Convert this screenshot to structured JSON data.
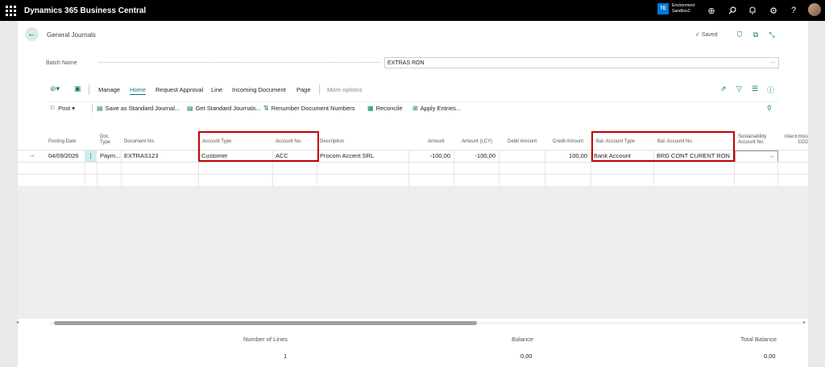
{
  "app": {
    "title": "Dynamics 365 Business Central"
  },
  "environment": {
    "badge": "TE",
    "label": "Environment:",
    "name": "Sandbox2"
  },
  "page": {
    "title": "General Journals",
    "status": "Saved"
  },
  "batch": {
    "label": "Batch Name",
    "value": "EXTRAS RON",
    "more": "···"
  },
  "actions": {
    "items": [
      "Manage",
      "Home",
      "Request Approval",
      "Line",
      "Incoming Document",
      "Page",
      "More options"
    ],
    "active": "Home"
  },
  "ribbon": {
    "post": "Post",
    "save_std": "Save as Standard Journal...",
    "get_std": "Get Standard Journals...",
    "renumber": "Renumber Document Numbers",
    "reconcile": "Reconcile",
    "apply": "Apply Entries..."
  },
  "columns": {
    "posting_date": "Posting Date",
    "doc_type": "Doc. Type",
    "doc_no": "Document No.",
    "account_type": "Account Type",
    "account_no": "Account No.",
    "description": "Description",
    "amount": "Amount",
    "amount_lcy": "Amount (LCY)",
    "debit": "Debit Amount",
    "credit": "Credit Amount",
    "bal_type": "Bal. Account Type",
    "bal_no": "Bal. Account No.",
    "sust_acc": "Sustainability Account No.",
    "total_emission": "Total Emiss CO2"
  },
  "rows": [
    {
      "posting_date": "04/09/2026",
      "doc_type": "Paym...",
      "doc_no": "EXTRAS123",
      "account_type": "Customer",
      "account_no": "ACC",
      "description": "Procom Accent SRL",
      "amount": "-100,00",
      "amount_lcy": "-100,00",
      "debit": "",
      "credit": "100,00",
      "bal_type": "Bank Account",
      "bal_no": "BRD CONT CURENT RON",
      "sust_acc": ""
    }
  ],
  "footer": {
    "lines_label": "Number of Lines",
    "lines_value": "1",
    "balance_label": "Balance",
    "balance_value": "0,00",
    "total_label": "Total Balance",
    "total_value": "0,00"
  },
  "colors": {
    "accent": "#0a7a6f",
    "highlight": "#c40000",
    "topbar": "#000000"
  }
}
